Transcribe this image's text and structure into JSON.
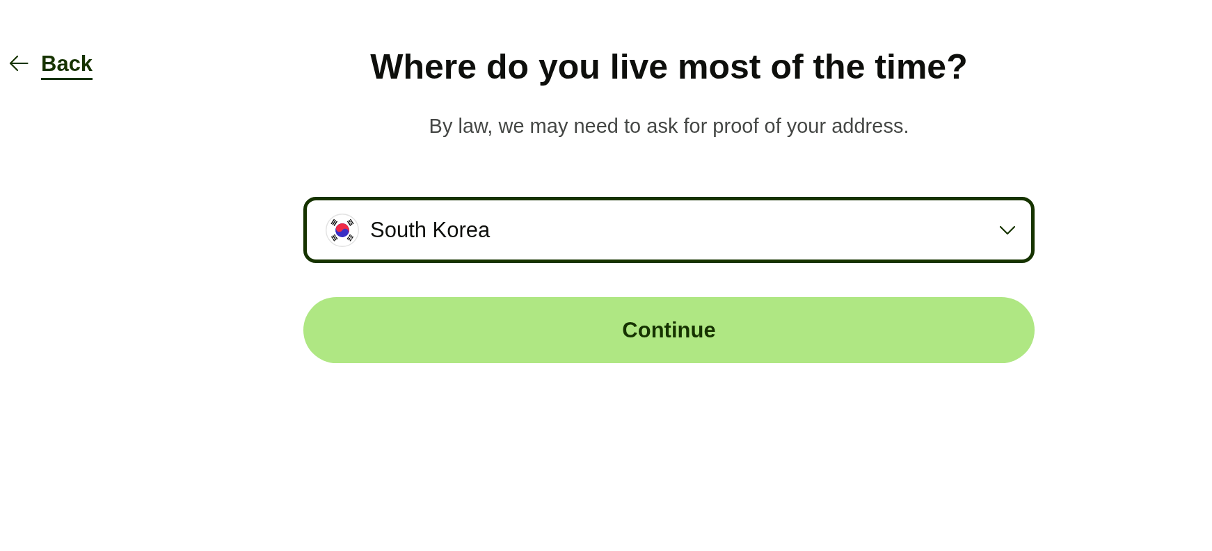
{
  "back_link": {
    "label": "Back"
  },
  "heading": "Where do you live most of the time?",
  "subheading": "By law, we may need to ask for proof of your address.",
  "country_select": {
    "value": "South Korea"
  },
  "continue_button": {
    "label": "Continue"
  }
}
